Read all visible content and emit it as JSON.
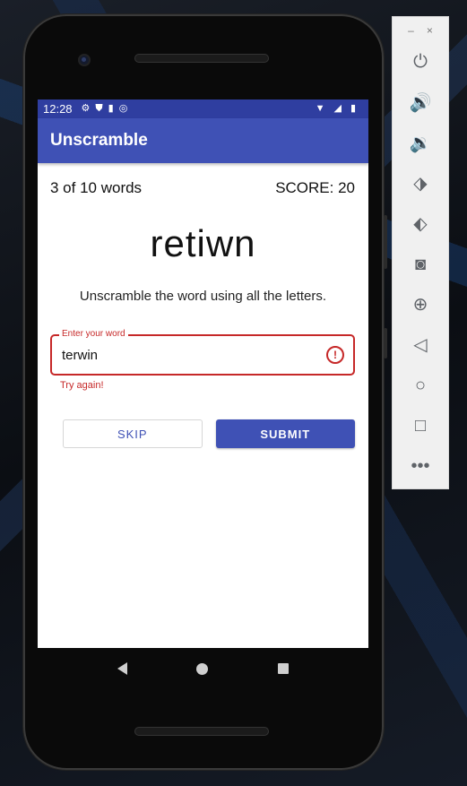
{
  "status_bar": {
    "time": "12:28"
  },
  "app_bar": {
    "title": "Unscramble"
  },
  "game": {
    "progress": "3 of 10 words",
    "score": "SCORE: 20",
    "scrambled_word": "retiwn",
    "instructions": "Unscramble the word using all the letters."
  },
  "input": {
    "label": "Enter your word",
    "value": "terwin",
    "error": "Try again!"
  },
  "buttons": {
    "skip": "SKIP",
    "submit": "SUBMIT"
  },
  "emulator_toolbar": {
    "minimize": "–",
    "close": "×",
    "items": [
      "power-icon",
      "volume-up-icon",
      "volume-down-icon",
      "rotate-left-icon",
      "rotate-right-icon",
      "camera-icon",
      "zoom-icon",
      "back-icon",
      "home-icon",
      "overview-icon",
      "more-icon"
    ]
  },
  "colors": {
    "primary": "#3f51b5",
    "primary_dark": "#2f3ea0",
    "error": "#c62828"
  }
}
